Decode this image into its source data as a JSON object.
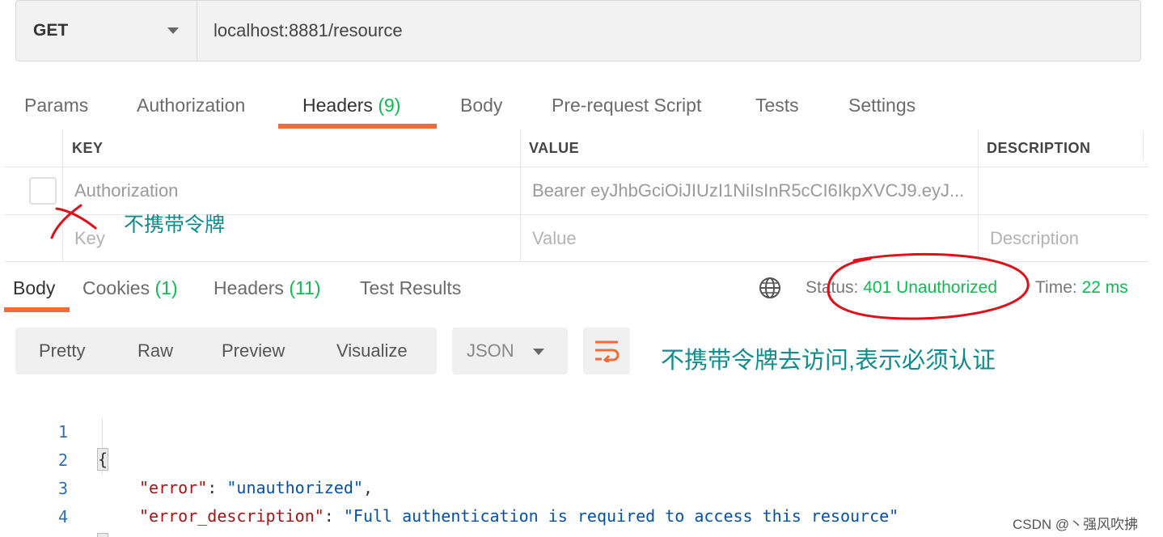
{
  "request": {
    "method": "GET",
    "url": "localhost:8881/resource"
  },
  "request_tabs": [
    {
      "label": "Params"
    },
    {
      "label": "Authorization"
    },
    {
      "label": "Headers",
      "count": "(9)"
    },
    {
      "label": "Body"
    },
    {
      "label": "Pre-request Script"
    },
    {
      "label": "Tests"
    },
    {
      "label": "Settings"
    }
  ],
  "headers_table": {
    "columns": [
      "KEY",
      "VALUE",
      "DESCRIPTION"
    ],
    "rows": [
      {
        "key": "Authorization",
        "value": "Bearer eyJhbGciOiJIUzI1NiIsInR5cCI6IkpXVCJ9.eyJ...",
        "description": ""
      }
    ],
    "placeholders": {
      "key": "Key",
      "value": "Value",
      "description": "Description"
    }
  },
  "annotations": {
    "no_token": "不携带令牌",
    "explain": "不携带令牌去访问,表示必须认证",
    "mark_color": "#e0101a"
  },
  "response_tabs": [
    {
      "label": "Body"
    },
    {
      "label": "Cookies",
      "count": "(1)"
    },
    {
      "label": "Headers",
      "count": "(11)"
    },
    {
      "label": "Test Results"
    }
  ],
  "response_status": {
    "status_label": "Status:",
    "status_value": "401 Unauthorized",
    "time_label": "Time:",
    "time_value": "22 ms"
  },
  "response_toolbar": {
    "views": [
      "Pretty",
      "Raw",
      "Preview",
      "Visualize"
    ],
    "format": "JSON"
  },
  "response_body": {
    "line_numbers": [
      "1",
      "2",
      "3",
      "4"
    ],
    "open_brace": "{",
    "close_brace": "}",
    "lines": [
      {
        "key": "\"error\"",
        "value": "\"unauthorized\"",
        "trail": ","
      },
      {
        "key": "\"error_description\"",
        "value": "\"Full authentication is required to access this resource\"",
        "trail": ""
      }
    ]
  },
  "watermark": "CSDN @丶强风吹拂",
  "colors": {
    "accent": "#f26b3a",
    "success": "#0cbb52",
    "annotation_text": "#108c8c"
  }
}
